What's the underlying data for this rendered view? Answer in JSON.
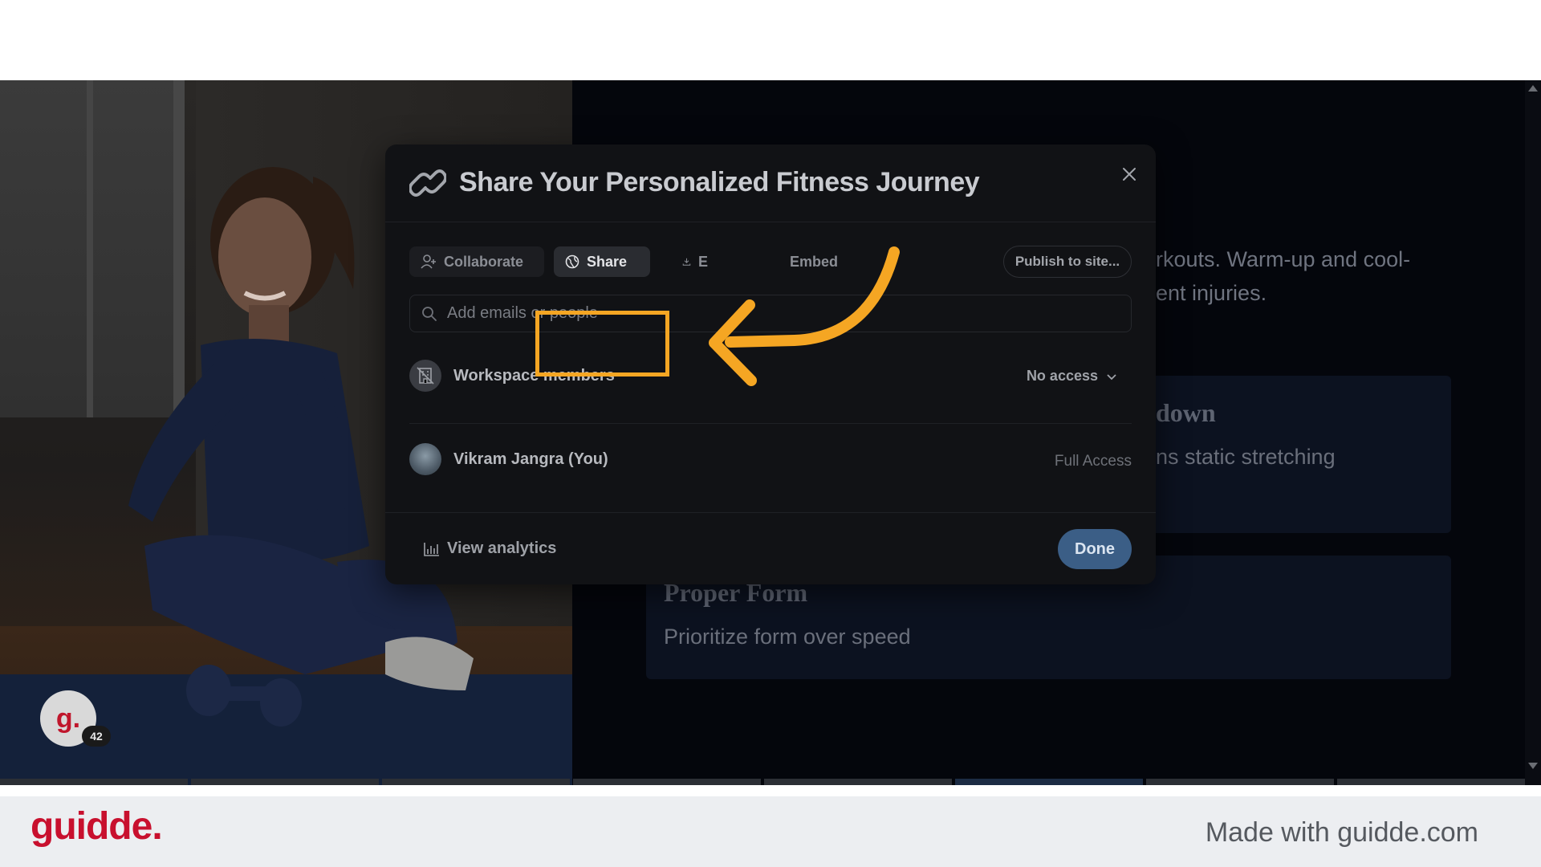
{
  "background": {
    "text_line_1": "rkouts. Warm-up and cool-",
    "text_line_2": "ent injuries.",
    "card_1_title": "down",
    "card_1_body": "ns static stretching",
    "card_2_title": "Proper Form",
    "card_2_body": "Prioritize form over speed"
  },
  "modal": {
    "title": "Share Your Personalized Fitness Journey",
    "tabs": {
      "collaborate": "Collaborate",
      "share": "Share",
      "export": "E",
      "embed": "Embed"
    },
    "publish_label": "Publish to site...",
    "search_placeholder": "Add emails or people",
    "members": [
      {
        "name": "Workspace members",
        "access": "No access"
      },
      {
        "name": "Vikram Jangra (You)",
        "access": "Full Access"
      }
    ],
    "footer": {
      "analytics_label": "View analytics",
      "done_label": "Done"
    }
  },
  "overlay": {
    "avatar_letter": "g.",
    "badge_count": "42",
    "highlight_color": "#f5a623"
  },
  "footer": {
    "logo": "guidde.",
    "made_with": "Made with guidde.com"
  },
  "colors": {
    "accent": "#f5a623",
    "done_button": "#3b5e86",
    "brand": "#c8102e"
  }
}
